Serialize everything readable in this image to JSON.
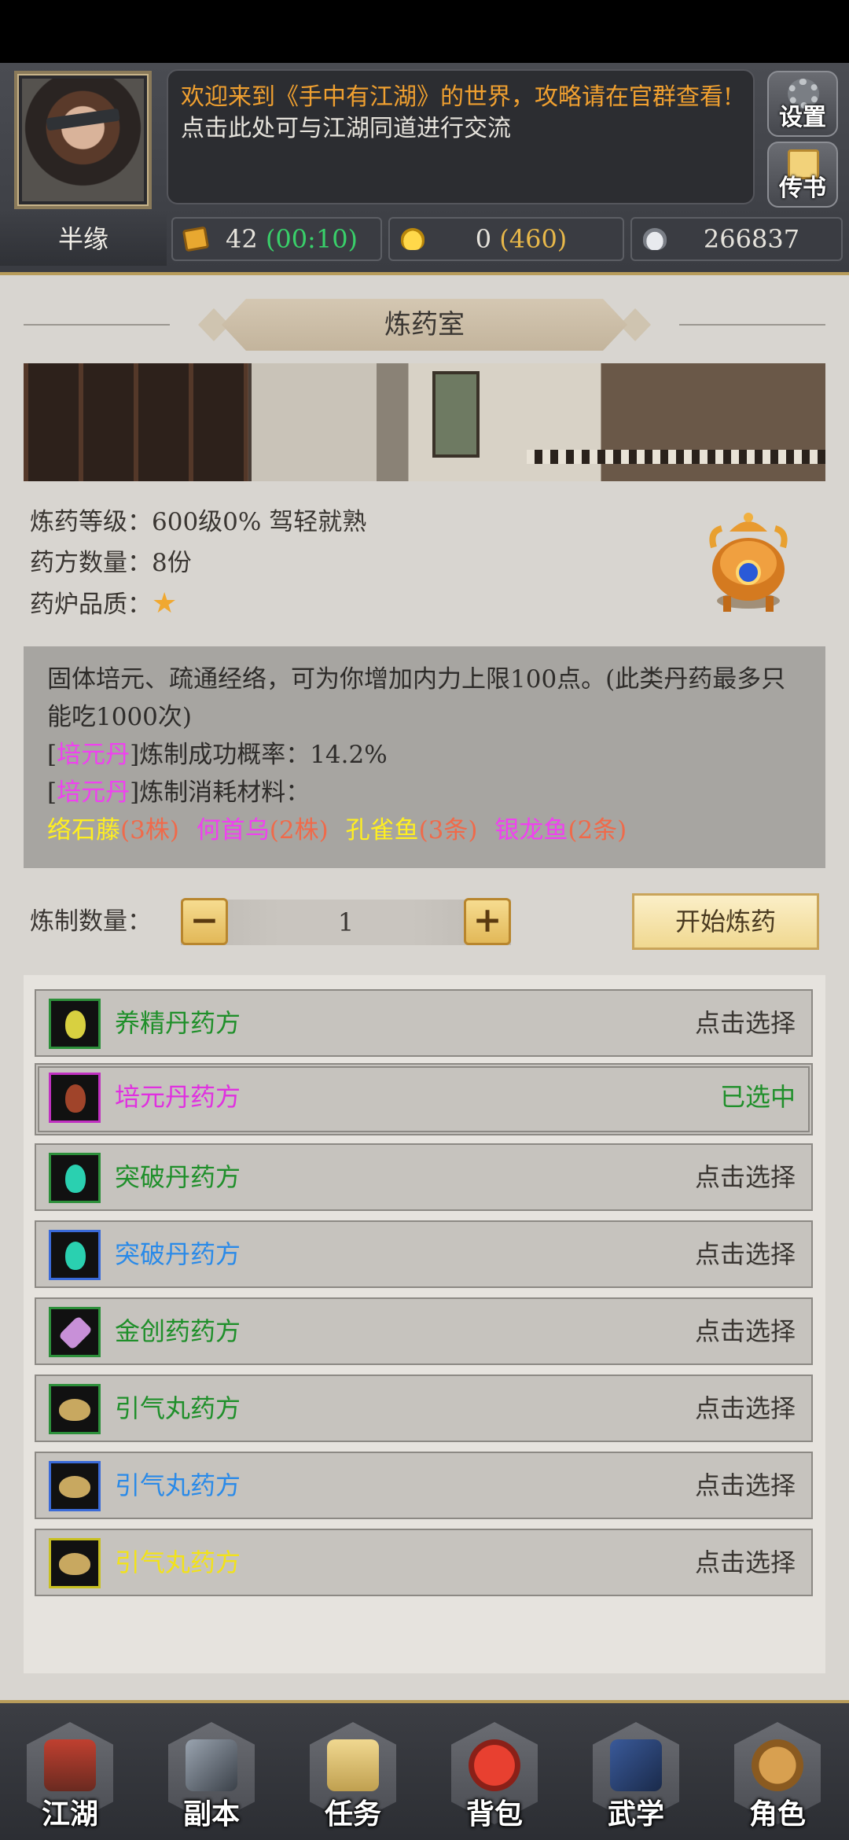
{
  "header": {
    "welcome_text": "欢迎来到《手中有江湖》的世界，攻略请在官群查看!",
    "chat_hint": "点击此处可与江湖同道进行交流",
    "settings_label": "设置",
    "mail_label": "传书",
    "player_name": "半缘",
    "resources": {
      "stamina_value": "42",
      "stamina_timer": "(00:10)",
      "gold_value": "0",
      "gold_extra": "(460)",
      "silver_value": "266837"
    }
  },
  "room": {
    "title": "炼药室",
    "level_text": "炼药等级：600级0%  驾轻就熟",
    "recipe_count_text": "药方数量：8份",
    "furnace_quality_label": "药炉品质：",
    "furnace_quality_stars": "★",
    "star_count": 1
  },
  "selected_pill": {
    "description": "固体培元、疏通经络，可为你增加内力上限100点。(此类丹药最多只能吃1000次)",
    "name": "培元丹",
    "success_text": "]炼制成功概率：14.2%",
    "materials_text": "]炼制消耗材料：",
    "materials": [
      {
        "name": "络石藤",
        "qty": "(3株)",
        "color": "#ffef20"
      },
      {
        "name": "何首乌",
        "qty": "(2株)",
        "color": "#f040f0"
      },
      {
        "name": "孔雀鱼",
        "qty": "(3条)",
        "color": "#ffef20"
      },
      {
        "name": "银龙鱼",
        "qty": "(2条)",
        "color": "#f040f0"
      }
    ]
  },
  "craft": {
    "quantity_label": "炼制数量：",
    "quantity_value": "1",
    "minus": "−",
    "plus": "+",
    "start_label": "开始炼药"
  },
  "recipes": [
    {
      "name": "养精丹药方",
      "state": "点击选择",
      "color": "#1f8f2a"
    },
    {
      "name": "培元丹药方",
      "state": "已选中",
      "color": "#e030e0"
    },
    {
      "name": "突破丹药方",
      "state": "点击选择",
      "color": "#1f8f2a"
    },
    {
      "name": "突破丹药方",
      "state": "点击选择",
      "color": "#2a8ae8"
    },
    {
      "name": "金创药药方",
      "state": "点击选择",
      "color": "#1f8f2a"
    },
    {
      "name": "引气丸药方",
      "state": "点击选择",
      "color": "#1f8f2a"
    },
    {
      "name": "引气丸药方",
      "state": "点击选择",
      "color": "#2a8ae8"
    },
    {
      "name": "引气丸药方",
      "state": "点击选择",
      "color": "#f2e21a"
    }
  ],
  "nav": [
    {
      "label": "江湖",
      "icon": "pagoda-icon"
    },
    {
      "label": "副本",
      "icon": "sword-icon"
    },
    {
      "label": "任务",
      "icon": "scroll-icon"
    },
    {
      "label": "背包",
      "icon": "bag-icon"
    },
    {
      "label": "武学",
      "icon": "book-icon"
    },
    {
      "label": "角色",
      "icon": "gourd-icon"
    }
  ]
}
